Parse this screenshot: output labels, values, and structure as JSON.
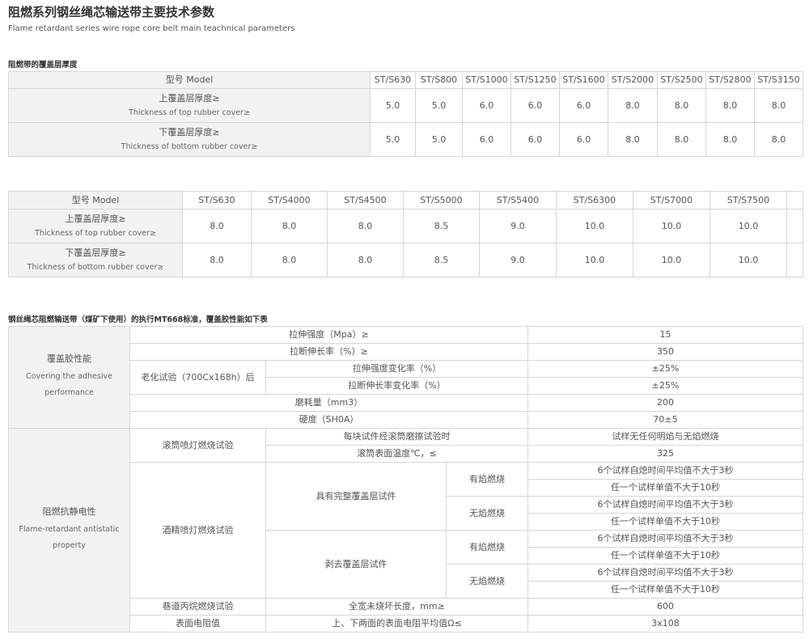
{
  "header": {
    "title": "阻燃系列钢丝绳芯输送带主要技术参数",
    "subtitle": "Flame retardant series wire rope core belt main teachnical parameters"
  },
  "section1": {
    "heading": "阻燃带的覆盖层厚度",
    "model_label": "型号 Model",
    "models": [
      "ST/S630",
      "ST/S800",
      "ST/S1000",
      "ST/S1250",
      "ST/S1600",
      "ST/S2000",
      "ST/S2500",
      "ST/S2800",
      "ST/S3150"
    ],
    "top_label_zh": "上覆盖层厚度≥",
    "top_label_en": "Thickness of top rubber cover≥",
    "top_values": [
      "5.0",
      "5.0",
      "6.0",
      "6.0",
      "6.0",
      "8.0",
      "8.0",
      "8.0",
      "8.0"
    ],
    "bottom_label_zh": "下覆盖层厚度≥",
    "bottom_label_en": "Thickness of bottom rubber cover≥",
    "bottom_values": [
      "5.0",
      "5.0",
      "6.0",
      "6.0",
      "6.0",
      "8.0",
      "8.0",
      "8.0",
      "8.0"
    ]
  },
  "section2": {
    "model_label": "型号 Model",
    "models": [
      "ST/S630",
      "ST/S4000",
      "ST/S4500",
      "ST/S5000",
      "ST/S5400",
      "ST/S6300",
      "ST/S7000",
      "ST/S7500",
      ""
    ],
    "top_label_zh": "上覆盖层厚度≥",
    "top_label_en": "Thickness of top rubber cover≥",
    "top_values": [
      "8.0",
      "8.0",
      "8.0",
      "8.5",
      "9.0",
      "10.0",
      "10.0",
      "10.0",
      ""
    ],
    "bottom_label_zh": "下覆盖层厚度≥",
    "bottom_label_en": "Thickness of bottom rubber cover≥",
    "bottom_values": [
      "8.0",
      "8.0",
      "8.0",
      "8.5",
      "9.0",
      "10.0",
      "10.0",
      "10.0",
      ""
    ]
  },
  "section3": {
    "heading": "钢丝绳芯阻燃输送带（煤矿下使用）的执行MT668标准，覆盖胶性能如下表",
    "cover": {
      "label_zh": "覆盖胶性能",
      "label_en": "Covering the adhesive performance",
      "tensile": "拉伸强度（Mpa）≥",
      "tensile_val": "15",
      "elong": "拉断伸长率（%）≥",
      "elong_val": "350",
      "aging": "老化试验（700Cx168h）后",
      "aging_tensile": "拉伸强度变化率（%）",
      "aging_tensile_val": "±25%",
      "aging_elong": "拉断伸长率变化率（%）",
      "aging_elong_val": "±25%",
      "wear": "磨耗量（mm3）",
      "wear_val": "200",
      "hardness": "硬度（SH0A）",
      "hardness_val": "70±5"
    },
    "flame": {
      "label_zh": "阻燃抗静电性",
      "label_en": "Flame-retardant antistatic property",
      "drum_test": "滚筒喷灯燃烧试验",
      "drum_each": "每块试件经滚筒磨擦试验时",
      "drum_each_val": "试样无任何明焰与无焰燃烧",
      "drum_temp": "滚筒表面温度℃，≤",
      "drum_temp_val": "325",
      "alcohol_test": "酒精喷灯燃烧试验",
      "full_cover": "具有完整覆盖层试件",
      "stripped": "剥去覆盖层试件",
      "flaming": "有焰燃烧",
      "flameless": "无焰燃烧",
      "avg_rule": "6个试样自熄时间平均值不大于3秒",
      "single_rule": "任一个试样单值不大于10秒",
      "tunnel_test": "巷道丙烷燃烧试验",
      "tunnel_desc": "全宽未烧坏长度，mm≥",
      "tunnel_val": "600",
      "resistance": "表面电阻值",
      "resistance_desc": "上、下两面的表面电阻平均值Ω≤",
      "resistance_val": "3x108"
    }
  }
}
